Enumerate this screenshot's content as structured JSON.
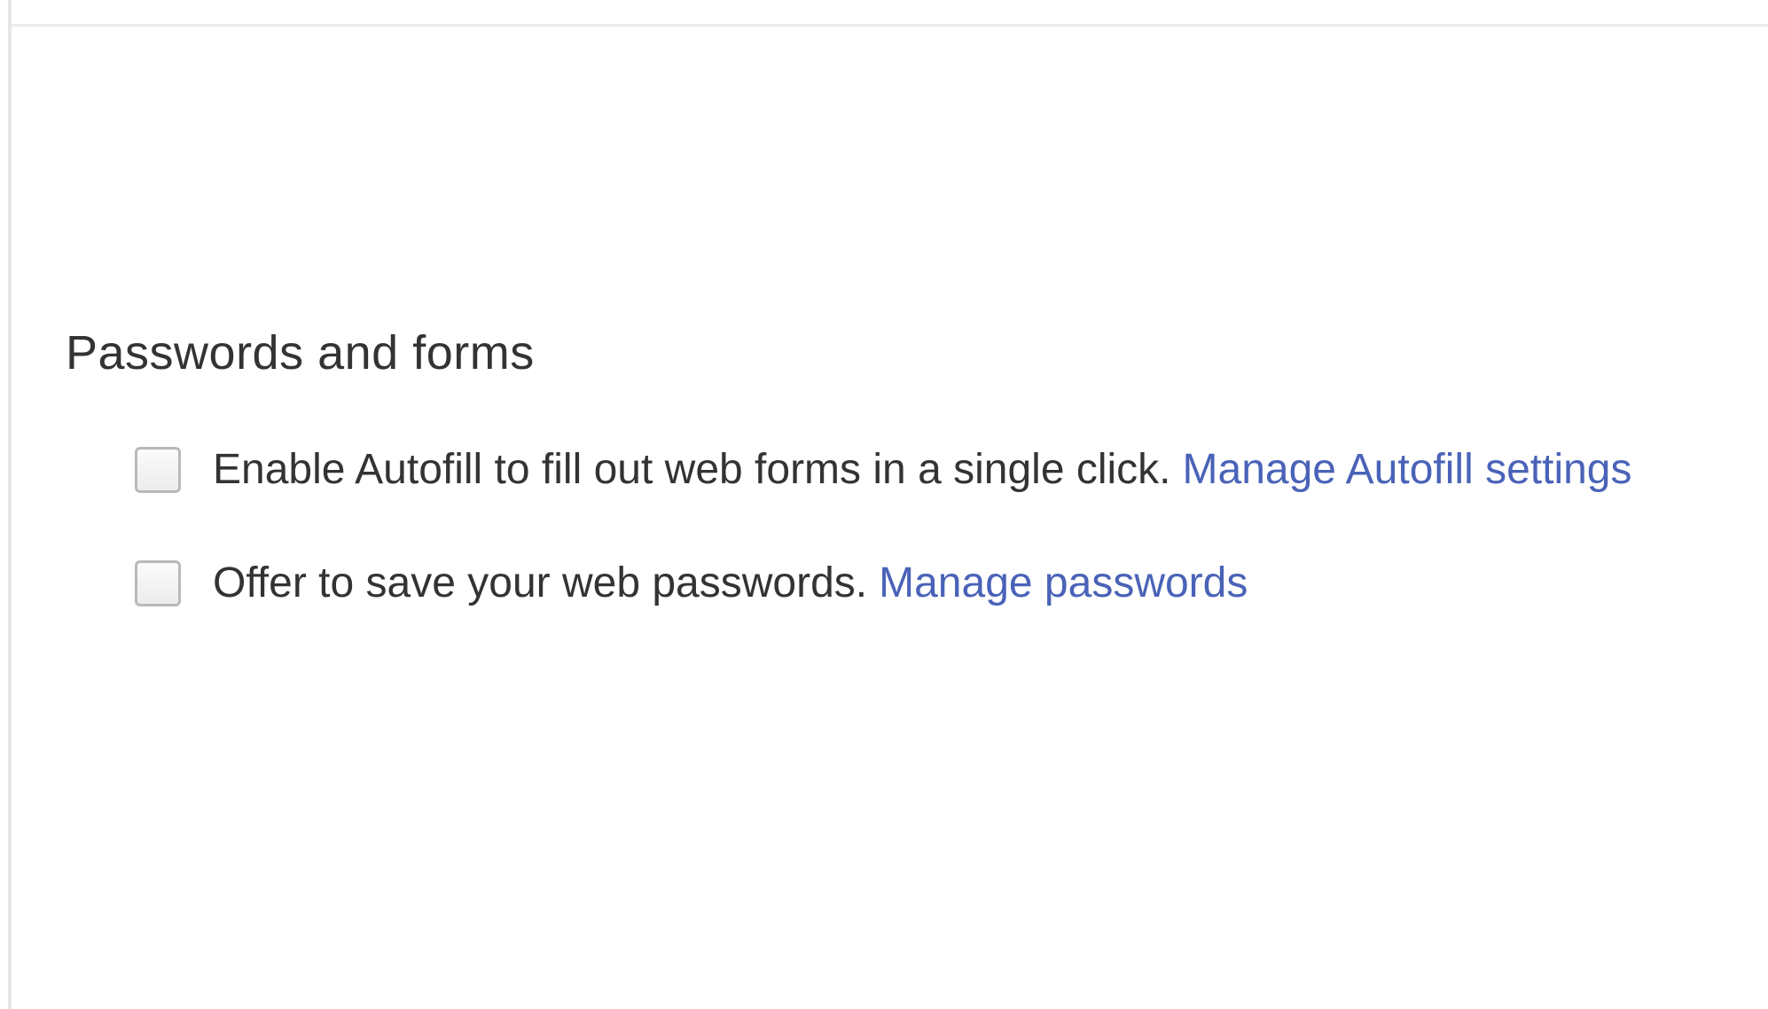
{
  "passwords_section": {
    "title": "Passwords and forms",
    "options": [
      {
        "label": "Enable Autofill to fill out web forms in a single click.",
        "link": "Manage Autofill settings",
        "checked": false
      },
      {
        "label": "Offer to save your web passwords.",
        "link": "Manage passwords",
        "checked": false
      }
    ]
  },
  "colors": {
    "text": "#333333",
    "link": "#4a63b8",
    "checkbox_border": "#b9b9b9",
    "divider": "#ececec"
  }
}
